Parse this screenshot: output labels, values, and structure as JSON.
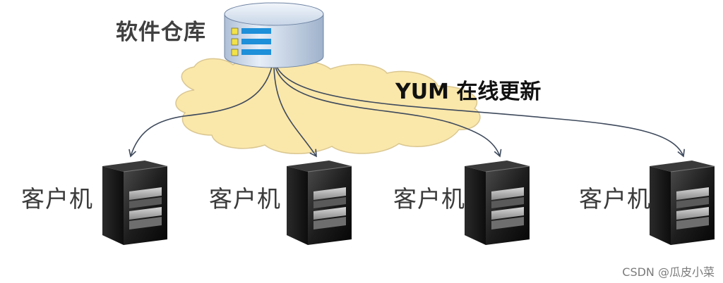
{
  "repository": {
    "label": "软件仓库",
    "icon": "database-icon"
  },
  "network": {
    "label": "YUM 在线更新",
    "icon": "cloud-icon"
  },
  "clients": [
    {
      "label": "客户机",
      "icon": "server-tower-icon"
    },
    {
      "label": "客户机",
      "icon": "server-tower-icon"
    },
    {
      "label": "客户机",
      "icon": "server-tower-icon"
    },
    {
      "label": "客户机",
      "icon": "server-tower-icon"
    }
  ],
  "watermark": "CSDN @瓜皮小菜",
  "colors": {
    "cloud_fill": "#fae6a6",
    "cloud_stroke": "#d9c58c",
    "database_fill": "#d4e2f2",
    "database_stripe": "#1e8fd9",
    "database_marker": "#f2e24a",
    "arrow": "#3e4a5c",
    "server_body": "#222222"
  }
}
